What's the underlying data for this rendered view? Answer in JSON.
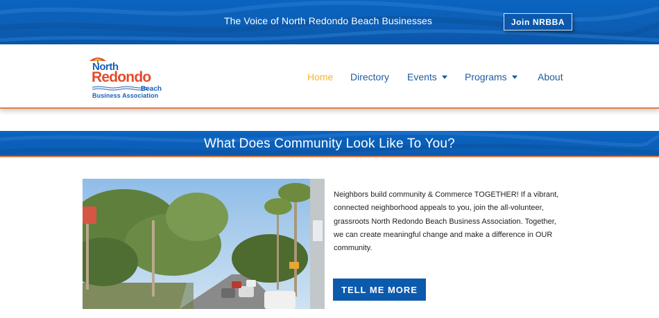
{
  "topbar": {
    "tagline": "The Voice of North Redondo Beach Businesses",
    "join_button": "Join NRBBA"
  },
  "logo": {
    "line1": "North",
    "line2": "Redondo",
    "line3": "Beach",
    "line4": "Business Association"
  },
  "nav": {
    "items": [
      {
        "label": "Home",
        "active": true,
        "dropdown": false
      },
      {
        "label": "Directory",
        "active": false,
        "dropdown": false
      },
      {
        "label": "Events",
        "active": false,
        "dropdown": true
      },
      {
        "label": "Programs",
        "active": false,
        "dropdown": true
      },
      {
        "label": "About",
        "active": false,
        "dropdown": false
      }
    ]
  },
  "banner": {
    "heading": "What Does Community Look Like To You?"
  },
  "main": {
    "paragraph": "Neighbors build community & Commerce TOGETHER! If a vibrant, connected neighborhood appeals to you, join the all-volunteer, grassroots North Redondo Beach Business Association. Together, we can create meaningful change and make a difference in OUR community.",
    "cta_button": "TELL ME MORE"
  },
  "colors": {
    "brand_blue": "#0b5aae",
    "accent_orange": "#e47a46",
    "active_nav": "#f2b52e",
    "nav_text": "#1d5a9f",
    "logo_red": "#e44b2c"
  },
  "icons": {
    "dropdown": "caret-down-icon",
    "logo_mark": "umbrella-logo-icon"
  }
}
